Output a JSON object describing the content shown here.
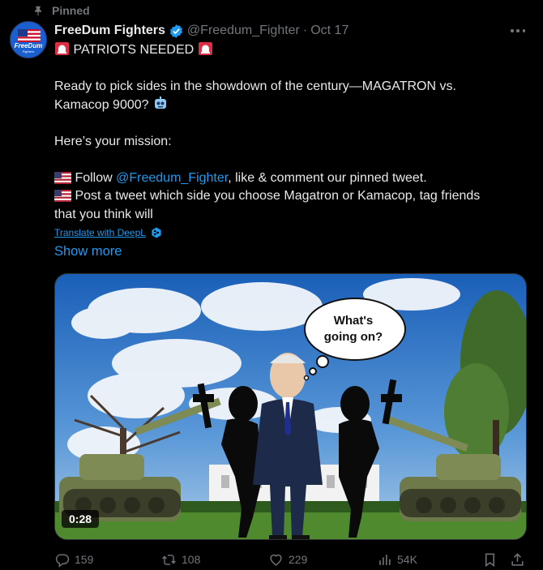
{
  "pinned_label": "Pinned",
  "author": {
    "name": "FreeDum Fighters",
    "handle": "@Freedum_Fighter",
    "separator": "·",
    "date": "Oct 17",
    "avatar_text": "FreeDum",
    "avatar_subtext": "Fighters"
  },
  "tweet": {
    "line1": "PATRIOTS NEEDED",
    "line2": "Ready to pick sides in the showdown of the century—MAGATRON vs.",
    "line3": "Kamacop 9000?",
    "line4": "Here’s your mission:",
    "line5_a": "Follow ",
    "line5_mention": "@Freedum_Fighter",
    "line5_b": ", like & comment our pinned tweet.",
    "line6": "Post a tweet which side you choose Magatron or Kamacop, tag friends",
    "line7": "that you think will"
  },
  "translate_label": "Translate with DeepL",
  "show_more_label": "Show more",
  "media": {
    "duration": "0:28",
    "speech_line1": "What's",
    "speech_line2": "going on?"
  },
  "actions": {
    "replies": "159",
    "reposts": "108",
    "likes": "229",
    "views": "54K"
  },
  "colors": {
    "background": "#000000",
    "text": "#e7e9ea",
    "muted": "#71767b",
    "accent": "#1d9bf0"
  }
}
